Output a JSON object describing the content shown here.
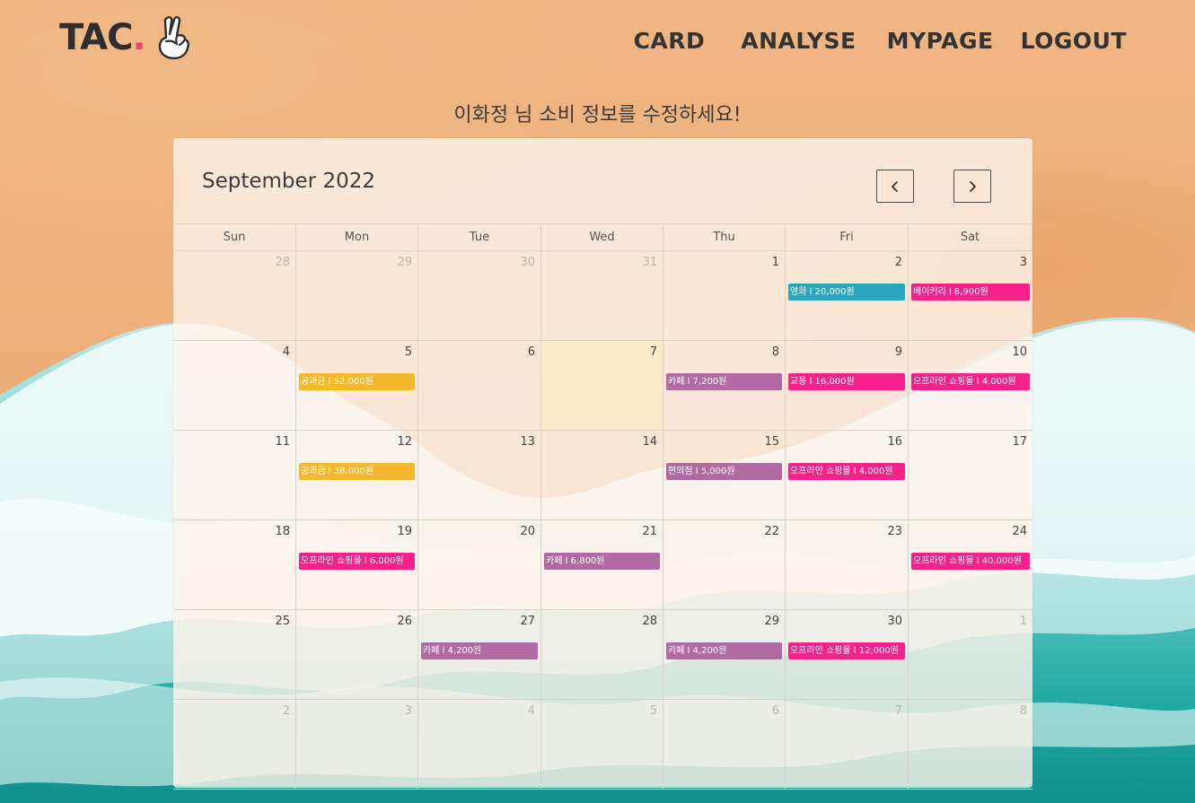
{
  "header": {
    "logo_text": "TAC",
    "logo_dot": ".",
    "nav": [
      "CARD",
      "ANALYSE",
      "MYPAGE",
      "LOGOUT"
    ]
  },
  "subtitle": "이화정 님 소비 정보를 수정하세요!",
  "calendar": {
    "title": "September 2022",
    "prev_icon": "chevron-left-icon",
    "next_icon": "chevron-right-icon",
    "weekdays": [
      "Sun",
      "Mon",
      "Tue",
      "Wed",
      "Thu",
      "Fri",
      "Sat"
    ],
    "today": "7",
    "weeks": [
      [
        {
          "day": "28",
          "other": true
        },
        {
          "day": "29",
          "other": true
        },
        {
          "day": "30",
          "other": true
        },
        {
          "day": "31",
          "other": true
        },
        {
          "day": "1"
        },
        {
          "day": "2",
          "event": {
            "label": "영화 l 20,000원",
            "color": "#2aa6c1"
          }
        },
        {
          "day": "3",
          "event": {
            "label": "베이커리 l 8,900원",
            "color": "#f4228a"
          }
        }
      ],
      [
        {
          "day": "4"
        },
        {
          "day": "5",
          "event": {
            "label": "공과금 l 52,000원",
            "color": "#f6b92e"
          }
        },
        {
          "day": "6"
        },
        {
          "day": "7",
          "today": true
        },
        {
          "day": "8",
          "event": {
            "label": "카페 l 7,200원",
            "color": "#b26aa3"
          }
        },
        {
          "day": "9",
          "event": {
            "label": "교통 l 16,000원",
            "color": "#f4228a"
          }
        },
        {
          "day": "10",
          "event": {
            "label": "오프라인 쇼핑몰 l 4,000원",
            "color": "#f4228a"
          }
        }
      ],
      [
        {
          "day": "11"
        },
        {
          "day": "12",
          "event": {
            "label": "공과금 l 38,000원",
            "color": "#f6b92e"
          }
        },
        {
          "day": "13"
        },
        {
          "day": "14"
        },
        {
          "day": "15",
          "event": {
            "label": "편의점 l 5,000원",
            "color": "#b26aa3"
          }
        },
        {
          "day": "16",
          "event": {
            "label": "오프라인 쇼핑몰 l 4,000원",
            "color": "#f4228a"
          }
        },
        {
          "day": "17"
        }
      ],
      [
        {
          "day": "18"
        },
        {
          "day": "19",
          "event": {
            "label": "오프라인 쇼핑몰 l 6,000원",
            "color": "#f4228a"
          }
        },
        {
          "day": "20"
        },
        {
          "day": "21",
          "event": {
            "label": "카페 l 6,800원",
            "color": "#b26aa3"
          }
        },
        {
          "day": "22"
        },
        {
          "day": "23"
        },
        {
          "day": "24",
          "event": {
            "label": "오프라인 쇼핑몰 l 40,000원",
            "color": "#f4228a"
          }
        }
      ],
      [
        {
          "day": "25"
        },
        {
          "day": "26"
        },
        {
          "day": "27",
          "event": {
            "label": "카페 l 4,200원",
            "color": "#b26aa3"
          }
        },
        {
          "day": "28"
        },
        {
          "day": "29",
          "event": {
            "label": "카페 l 4,200원",
            "color": "#b26aa3"
          }
        },
        {
          "day": "30",
          "event": {
            "label": "오프라인 쇼핑몰 l 12,000원",
            "color": "#f4228a"
          }
        },
        {
          "day": "1",
          "other": true
        }
      ],
      [
        {
          "day": "2",
          "other": true
        },
        {
          "day": "3",
          "other": true
        },
        {
          "day": "4",
          "other": true
        },
        {
          "day": "5",
          "other": true
        },
        {
          "day": "6",
          "other": true
        },
        {
          "day": "7",
          "other": true
        },
        {
          "day": "8",
          "other": true
        }
      ]
    ]
  },
  "colors": {
    "accent_dot": "#f0466e",
    "today_bg": "#fcecc8",
    "sand": "#eeb37e",
    "sea": "#1fa89f"
  }
}
